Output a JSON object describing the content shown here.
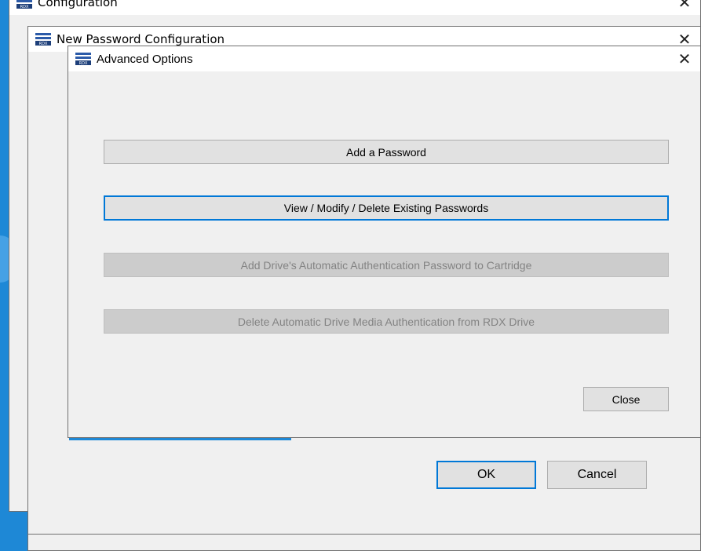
{
  "windows": {
    "back": {
      "title": "Configuration",
      "close_glyph": "✕"
    },
    "middle": {
      "title": "New Password Configuration",
      "close_glyph": "✕"
    },
    "front": {
      "title": "Advanced Options",
      "close_glyph": "✕"
    }
  },
  "advanced_options": {
    "buttons": [
      {
        "label": "Add a Password",
        "state": "normal"
      },
      {
        "label": "View / Modify / Delete Existing Passwords",
        "state": "focused"
      },
      {
        "label": "Add Drive's Automatic Authentication Password to Cartridge",
        "state": "disabled"
      },
      {
        "label": "Delete Automatic Drive Media Authentication from RDX Drive",
        "state": "disabled"
      }
    ],
    "close_label": "Close"
  },
  "password_config": {
    "ok_label": "OK",
    "cancel_label": "Cancel"
  },
  "colors": {
    "desktop": "#1e88d6",
    "focus_border": "#0078d7",
    "dialog_bg": "#f0f0f0"
  }
}
